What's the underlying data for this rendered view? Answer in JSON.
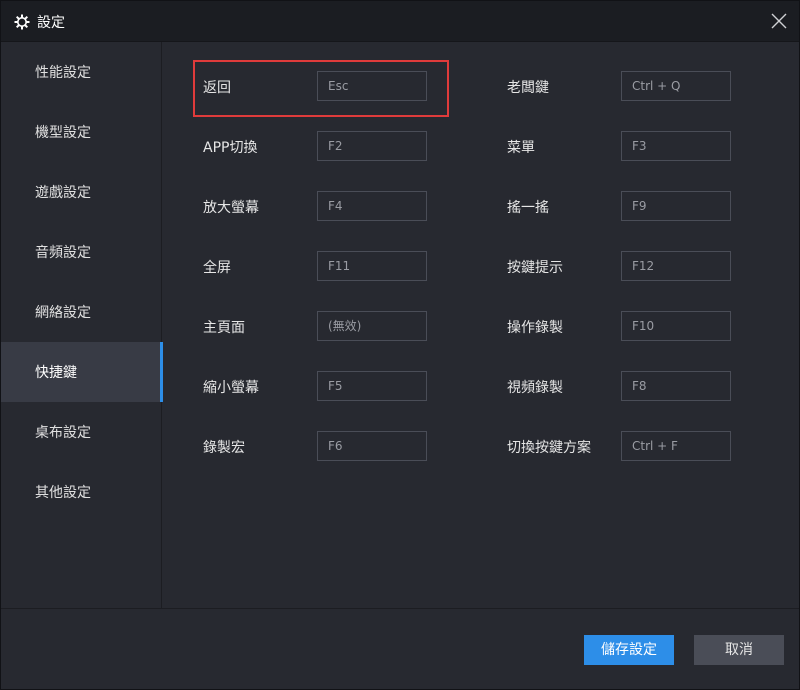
{
  "window": {
    "title": "設定",
    "icon": "gear-icon",
    "close_icon": "close-icon"
  },
  "sidebar": {
    "items": [
      {
        "label": "性能設定",
        "active": false
      },
      {
        "label": "機型設定",
        "active": false
      },
      {
        "label": "遊戲設定",
        "active": false
      },
      {
        "label": "音頻設定",
        "active": false
      },
      {
        "label": "網絡設定",
        "active": false
      },
      {
        "label": "快捷鍵",
        "active": true
      },
      {
        "label": "桌布設定",
        "active": false
      },
      {
        "label": "其他設定",
        "active": false
      }
    ]
  },
  "shortcuts": {
    "left": [
      {
        "label": "返回",
        "key": "Esc"
      },
      {
        "label": "APP切換",
        "key": "F2"
      },
      {
        "label": "放大螢幕",
        "key": "F4"
      },
      {
        "label": "全屏",
        "key": "F11"
      },
      {
        "label": "主頁面",
        "key": "(無效)"
      },
      {
        "label": "縮小螢幕",
        "key": "F5"
      },
      {
        "label": "錄製宏",
        "key": "F6"
      }
    ],
    "right": [
      {
        "label": "老闆鍵",
        "key": "Ctrl + Q"
      },
      {
        "label": "菜單",
        "key": "F3"
      },
      {
        "label": "搖一搖",
        "key": "F9"
      },
      {
        "label": "按鍵提示",
        "key": "F12"
      },
      {
        "label": "操作錄製",
        "key": "F10"
      },
      {
        "label": "視頻錄製",
        "key": "F8"
      },
      {
        "label": "切換按鍵方案",
        "key": "Ctrl + F"
      }
    ]
  },
  "footer": {
    "save_label": "儲存設定",
    "cancel_label": "取消"
  },
  "colors": {
    "accent": "#2d8ee8",
    "highlight": "#e03b3b",
    "background": "#272930",
    "titlebar": "#1b1d22"
  }
}
